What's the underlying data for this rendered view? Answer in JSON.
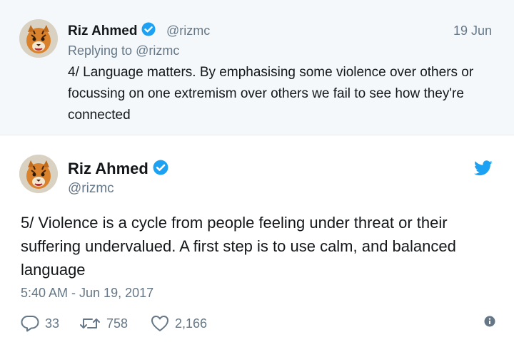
{
  "parent_tweet": {
    "author_name": "Riz Ahmed",
    "handle": "@rizmc",
    "date": "19 Jun",
    "replying_prefix": "Replying to",
    "replying_to": "@rizmc",
    "text": "4/ Language matters. By emphasising some violence over others or focussing on one extremism over others we fail to see how they're connected"
  },
  "main_tweet": {
    "author_name": "Riz Ahmed",
    "handle": "@rizmc",
    "text": "5/ Violence is a cycle from people feeling under threat or their suffering undervalued. A first step is to use calm, and balanced language",
    "timestamp": "5:40 AM - Jun 19, 2017",
    "replies": "33",
    "retweets": "758",
    "likes": "2,166"
  },
  "icons": {
    "verified": "verified-badge-icon",
    "brand": "twitter-bird-icon",
    "reply": "reply-bubble-icon",
    "retweet": "retweet-icon",
    "like": "heart-icon",
    "info": "info-icon"
  },
  "colors": {
    "accent": "#1da1f2",
    "muted_text": "#657786",
    "parent_background": "#f5f8fa"
  }
}
